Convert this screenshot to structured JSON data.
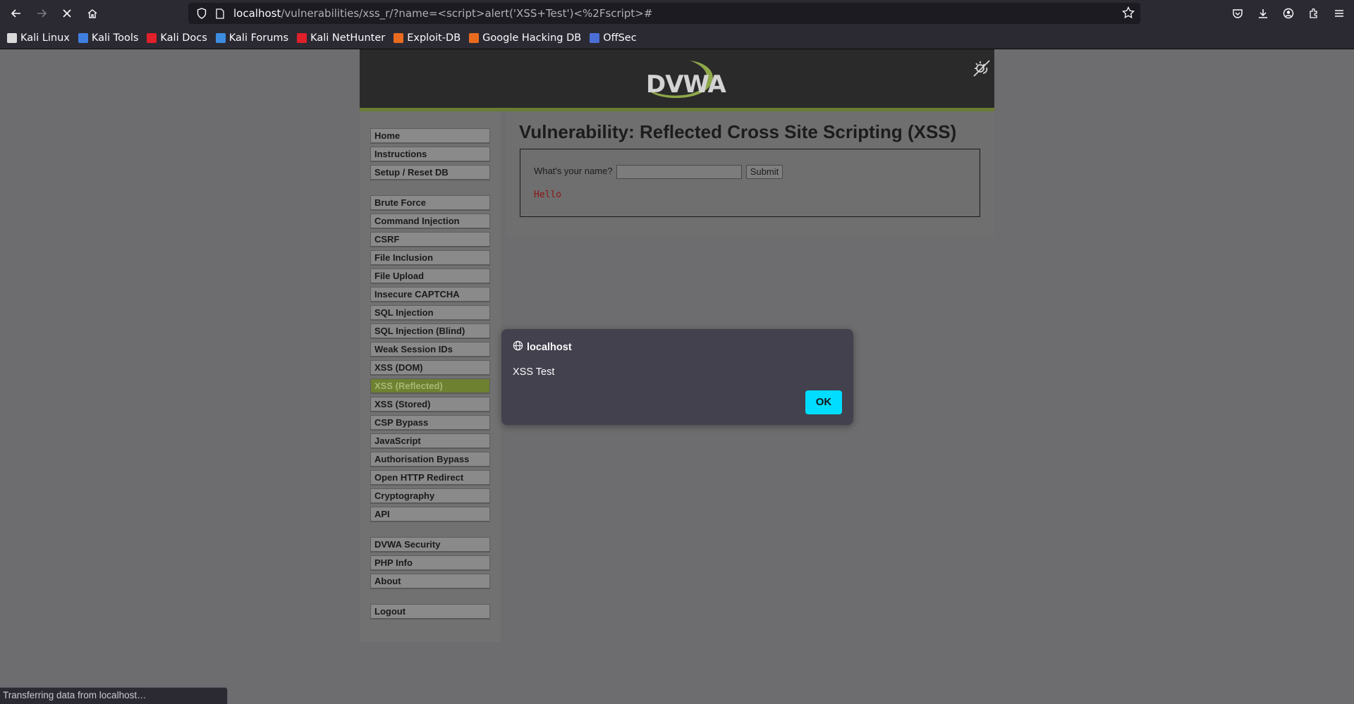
{
  "browser": {
    "url_host": "localhost",
    "url_path": "/vulnerabilities/xss_r/?name=<script>alert('XSS+Test')<%2Fscript>#",
    "status_text": "Transferring data from localhost…",
    "bookmarks": [
      {
        "label": "Kali Linux",
        "icon": "kali-icon",
        "color": "#d9d9d9"
      },
      {
        "label": "Kali Tools",
        "icon": "kali-tools-icon",
        "color": "#3f7fe0"
      },
      {
        "label": "Kali Docs",
        "icon": "kali-docs-icon",
        "color": "#e0202a"
      },
      {
        "label": "Kali Forums",
        "icon": "kali-forums-icon",
        "color": "#3c8de0"
      },
      {
        "label": "Kali NetHunter",
        "icon": "nethunter-icon",
        "color": "#e0202a"
      },
      {
        "label": "Exploit-DB",
        "icon": "exploit-db-icon",
        "color": "#e96b1f"
      },
      {
        "label": "Google Hacking DB",
        "icon": "ghdb-icon",
        "color": "#e96b1f"
      },
      {
        "label": "OffSec",
        "icon": "offsec-icon",
        "color": "#4a6fd6"
      }
    ]
  },
  "dvwa": {
    "logo_text": "DVWA",
    "page_title": "Vulnerability: Reflected Cross Site Scripting (XSS)",
    "form_label": "What's your name?",
    "submit_label": "Submit",
    "input_value": "",
    "output_text": "Hello",
    "menu": [
      {
        "label": "Home",
        "active": false
      },
      {
        "label": "Instructions",
        "active": false
      },
      {
        "label": "Setup / Reset DB",
        "active": false
      },
      {
        "label": "Brute Force",
        "active": false
      },
      {
        "label": "Command Injection",
        "active": false
      },
      {
        "label": "CSRF",
        "active": false
      },
      {
        "label": "File Inclusion",
        "active": false
      },
      {
        "label": "File Upload",
        "active": false
      },
      {
        "label": "Insecure CAPTCHA",
        "active": false
      },
      {
        "label": "SQL Injection",
        "active": false
      },
      {
        "label": "SQL Injection (Blind)",
        "active": false
      },
      {
        "label": "Weak Session IDs",
        "active": false
      },
      {
        "label": "XSS (DOM)",
        "active": false
      },
      {
        "label": "XSS (Reflected)",
        "active": true
      },
      {
        "label": "XSS (Stored)",
        "active": false
      },
      {
        "label": "CSP Bypass",
        "active": false
      },
      {
        "label": "JavaScript",
        "active": false
      },
      {
        "label": "Authorisation Bypass",
        "active": false
      },
      {
        "label": "Open HTTP Redirect",
        "active": false
      },
      {
        "label": "Cryptography",
        "active": false
      },
      {
        "label": "API",
        "active": false
      },
      {
        "label": "DVWA Security",
        "active": false
      },
      {
        "label": "PHP Info",
        "active": false
      },
      {
        "label": "About",
        "active": false
      },
      {
        "label": "Logout",
        "active": false
      }
    ]
  },
  "dialog": {
    "origin": "localhost",
    "message": "XSS Test",
    "ok_label": "OK"
  },
  "colors": {
    "accent_green": "#6a7d32",
    "dialog_button": "#00ddff"
  }
}
